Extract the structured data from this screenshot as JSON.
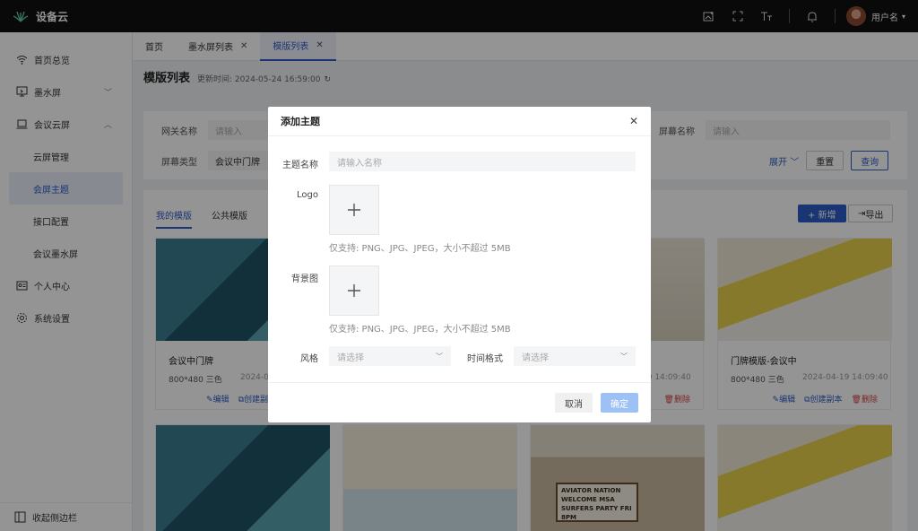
{
  "app": {
    "name": "设备云",
    "username": "用户名"
  },
  "top_icons": [
    "image-add-icon",
    "fullscreen-icon",
    "font-size-icon",
    "bell-icon"
  ],
  "sidebar": {
    "items": [
      {
        "label": "首页总览",
        "icon": "wifi-icon"
      },
      {
        "label": "墨水屏",
        "icon": "monitor-icon"
      },
      {
        "label": "会议云屏",
        "icon": "laptop-icon"
      }
    ],
    "sub_items": [
      "云屏管理",
      "会屏主题",
      "接口配置",
      "会议墨水屏"
    ],
    "items2": [
      {
        "label": "个人中心",
        "icon": "id-card-icon"
      },
      {
        "label": "系统设置",
        "icon": "gear-icon"
      }
    ],
    "collapse_label": "收起侧边栏"
  },
  "tabs": [
    {
      "label": "首页"
    },
    {
      "label": "墨水屏列表"
    },
    {
      "label": "模版列表"
    }
  ],
  "page": {
    "title": "模版列表",
    "update_label": "更新时间: 2024-05-24 16:59:00"
  },
  "filters": {
    "gateway_label": "网关名称",
    "gateway_placeholder": "请输入",
    "screen_name_label": "屏幕名称",
    "screen_name_placeholder": "请输入",
    "screen_type_label": "屏幕类型",
    "screen_type_value": "会议中门牌",
    "expand_label": "展开",
    "reset_label": "重置",
    "query_label": "查询"
  },
  "list": {
    "tab_mine": "我的模版",
    "tab_public": "公共模版",
    "add_label": "+ 新增",
    "export_label": "导出",
    "cards": [
      {
        "name": "会议中门牌",
        "meta": "800*480 三色",
        "date": "2024-0",
        "edit": "编辑",
        "copy": "创建副",
        "del": ""
      },
      {
        "name": "",
        "meta": "",
        "date": "19 14:09:40",
        "edit": "",
        "copy": "",
        "del": "删除"
      },
      {
        "name": "门牌模版-会议中",
        "meta": "800*480 三色",
        "date": "2024-04-19 14:09:40",
        "edit": "编辑",
        "copy": "创建副本",
        "del": "删除"
      }
    ],
    "sign_text": "AVIATOR NATION WELCOME MSA SURFERS PARTY FRI 8PM"
  },
  "modal": {
    "title": "添加主题",
    "name_label": "主题名称",
    "name_placeholder": "请输入名称",
    "logo_label": "Logo",
    "logo_hint": "仅支持: PNG、JPG、JPEG，大小不超过 5MB",
    "bg_label": "背景图",
    "bg_hint": "仅支持: PNG、JPG、JPEG，大小不超过 5MB",
    "style_label": "风格",
    "style_placeholder": "请选择",
    "time_label": "时间格式",
    "time_placeholder": "请选择",
    "cancel_label": "取消",
    "ok_label": "确定"
  },
  "colors": {
    "accent": "#2d5cc7",
    "danger": "#d94040",
    "topbar": "#111111",
    "ok_disabled": "#9ec1f5"
  }
}
